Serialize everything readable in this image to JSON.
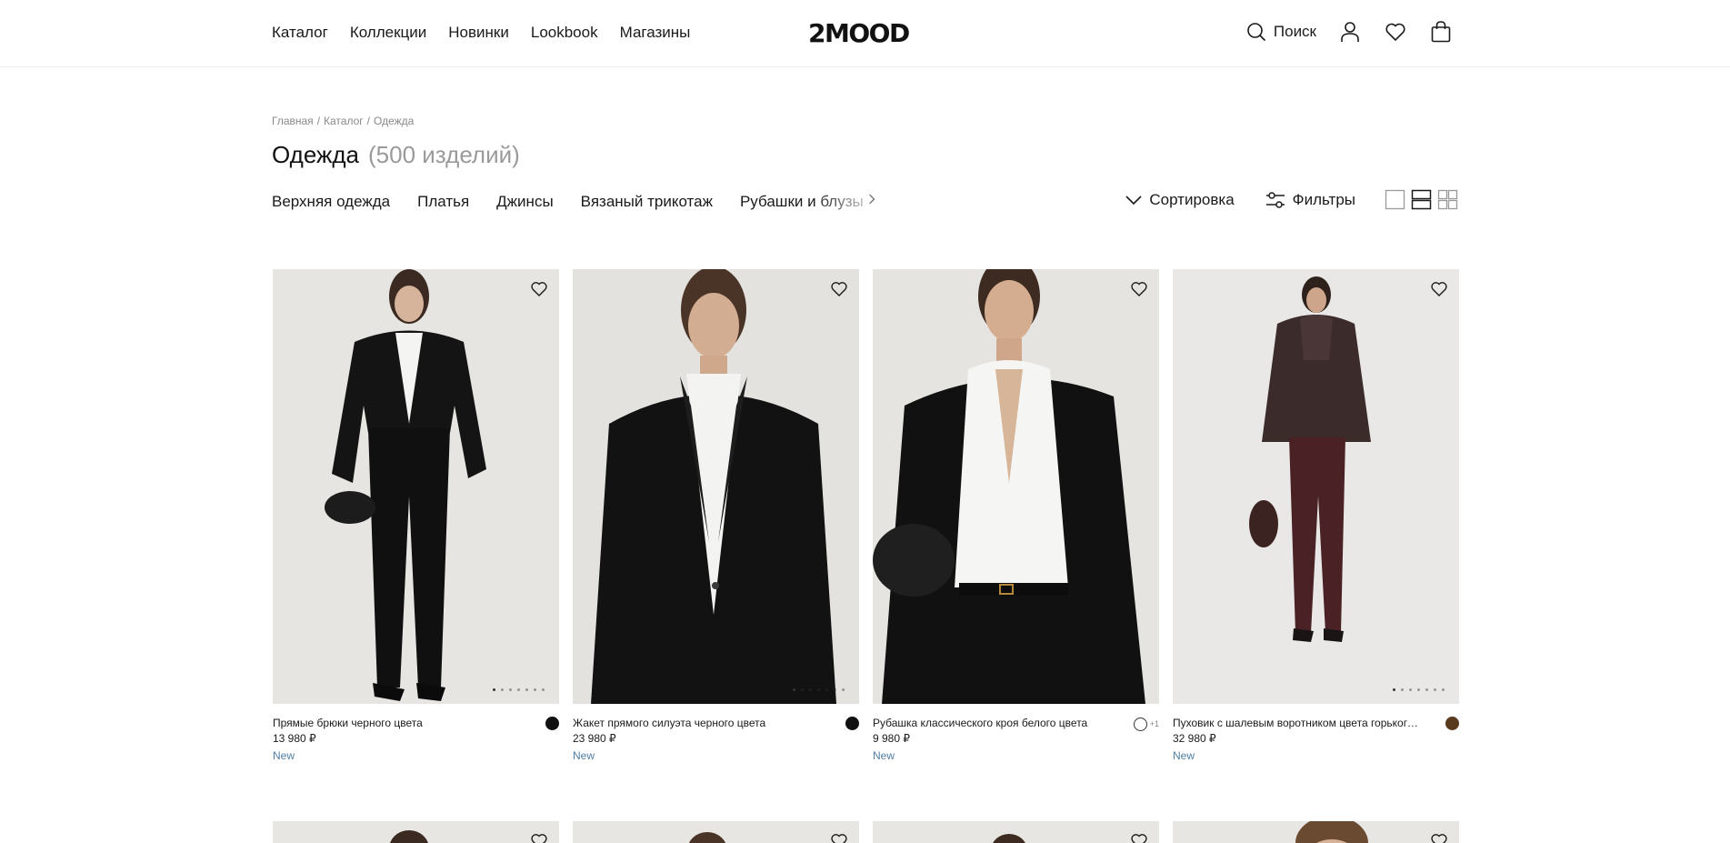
{
  "header": {
    "nav": [
      "Каталог",
      "Коллекции",
      "Новинки",
      "Lookbook",
      "Магазины"
    ],
    "logo": "2MOOD",
    "search_label": "Поиск"
  },
  "breadcrumb": {
    "items": [
      "Главная",
      "Каталог",
      "Одежда"
    ],
    "separator": "/"
  },
  "page": {
    "title": "Одежда",
    "count": "(500 изделий)"
  },
  "categories": [
    "Верхняя одежда",
    "Платья",
    "Джинсы",
    "Вязаный трикотаж",
    "Рубашки и блузы"
  ],
  "tools": {
    "sort_label": "Сортировка",
    "filter_label": "Фильтры"
  },
  "products": [
    {
      "name": "Прямые брюки черного цвета",
      "price": "13 980 ₽",
      "badge": "New",
      "colors": [
        "#111111"
      ],
      "more_colors": "",
      "image": "model-black-trousers"
    },
    {
      "name": "Жакет прямого силуэта черного цвета",
      "price": "23 980 ₽",
      "badge": "New",
      "colors": [
        "#111111"
      ],
      "more_colors": "",
      "image": "model-black-blazer"
    },
    {
      "name": "Рубашка классического кроя белого цвета",
      "price": "9 980 ₽",
      "badge": "New",
      "colors": [
        "#ffffff"
      ],
      "more_colors": "+1",
      "image": "model-white-shirt"
    },
    {
      "name": "Пуховик с шалевым воротником цвета горького шоколада",
      "price": "32 980 ₽",
      "badge": "New",
      "colors": [
        "#5a3a1e"
      ],
      "more_colors": "",
      "image": "model-brown-puffer"
    }
  ],
  "colors": {
    "text": "#1a1a1a",
    "muted": "#9a9a9a",
    "badge": "#4f7fa8",
    "photo_bg": "#e6e4e1"
  }
}
